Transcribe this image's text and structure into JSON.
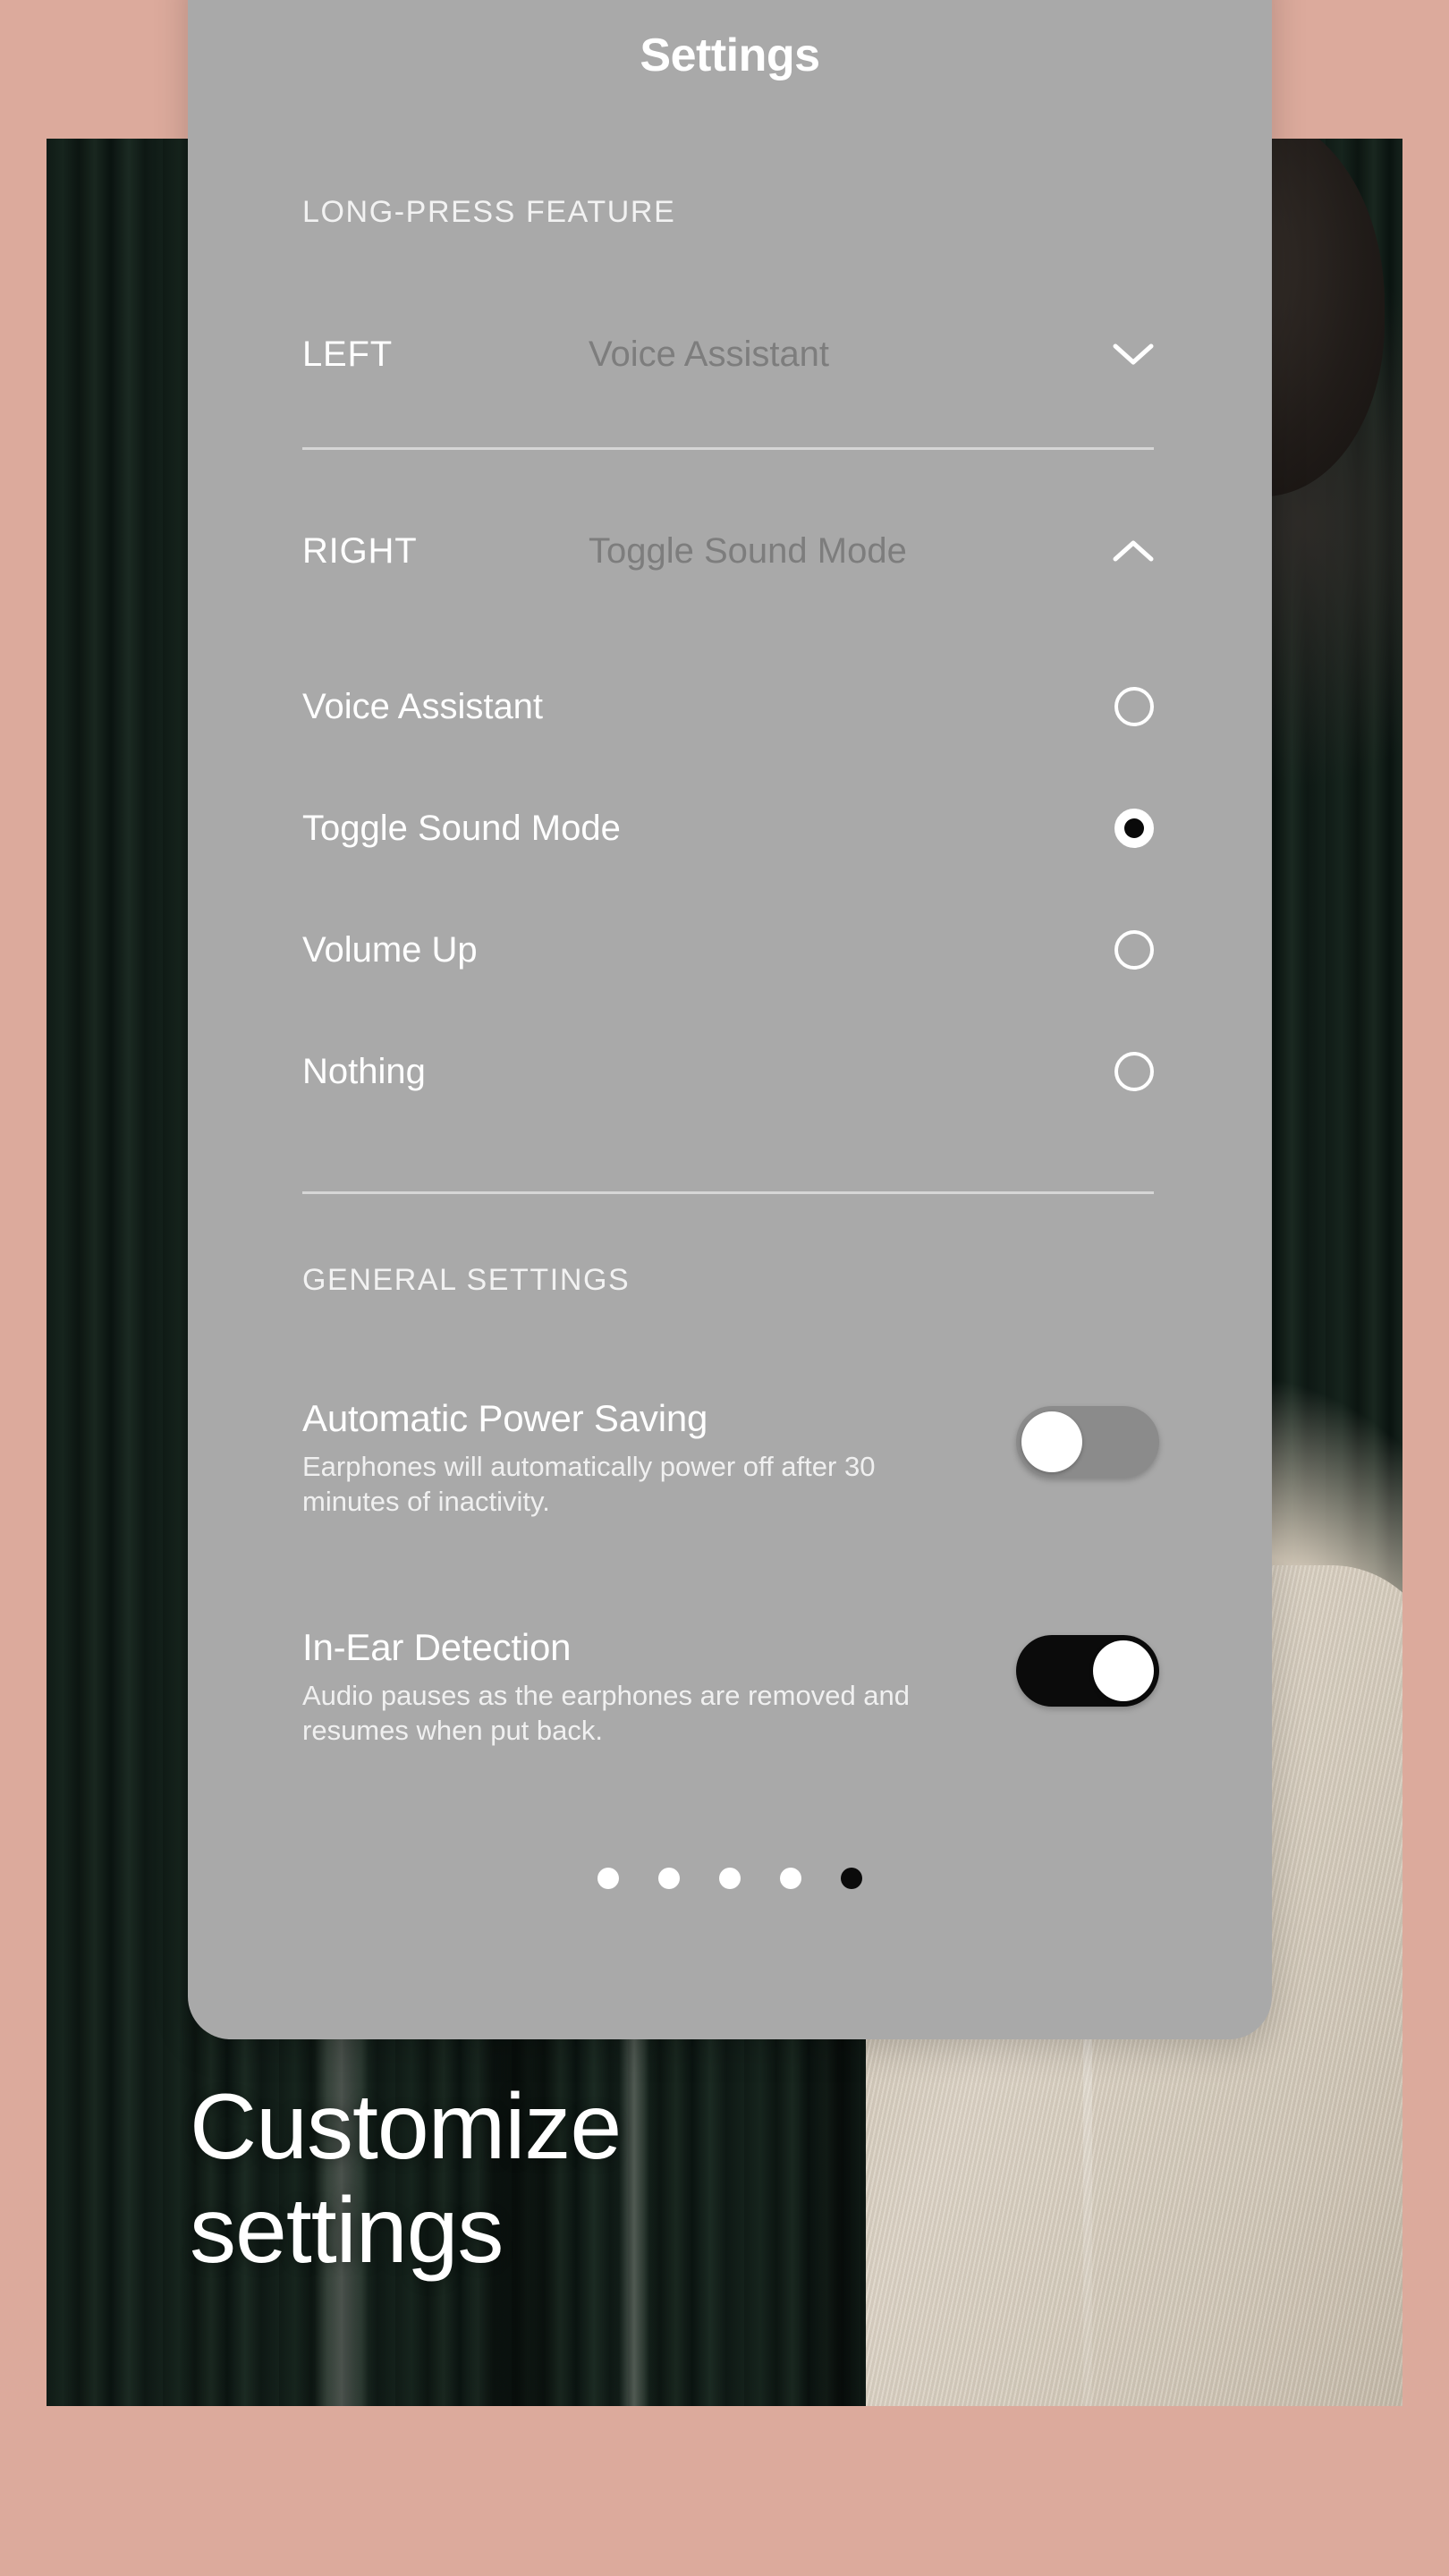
{
  "caption": {
    "line1": "Customize",
    "line2": "settings"
  },
  "card": {
    "title": "Settings",
    "sections": {
      "long_press": {
        "label": "LONG-PRESS FEATURE",
        "rows": [
          {
            "side": "LEFT",
            "value": "Voice Assistant",
            "chevron": "chevron-down-icon"
          },
          {
            "side": "RIGHT",
            "value": "Toggle Sound Mode",
            "chevron": "chevron-up-icon"
          }
        ],
        "options": [
          {
            "label": "Voice Assistant",
            "selected": false
          },
          {
            "label": "Toggle Sound Mode",
            "selected": true
          },
          {
            "label": "Volume Up",
            "selected": false
          },
          {
            "label": "Nothing",
            "selected": false
          }
        ]
      },
      "general": {
        "label": "GENERAL SETTINGS",
        "preferences": [
          {
            "title": "Automatic Power Saving",
            "description": "Earphones will automatically power off after 30 minutes of inactivity.",
            "enabled": false
          },
          {
            "title": "In-Ear Detection",
            "description": "Audio pauses as the earphones are removed and resumes when put back.",
            "enabled": true
          }
        ]
      }
    },
    "pagination": {
      "count": 5,
      "active_index": 4
    }
  },
  "colors": {
    "page_background": "#dcaa9c",
    "card_background": "#a9a9a9",
    "primary_text": "#ffffff",
    "muted_value_text": "#7d7d7d",
    "toggle_on": "#0b0b0b",
    "toggle_off": "#8b8b8b",
    "divider": "#d6d6d6"
  }
}
